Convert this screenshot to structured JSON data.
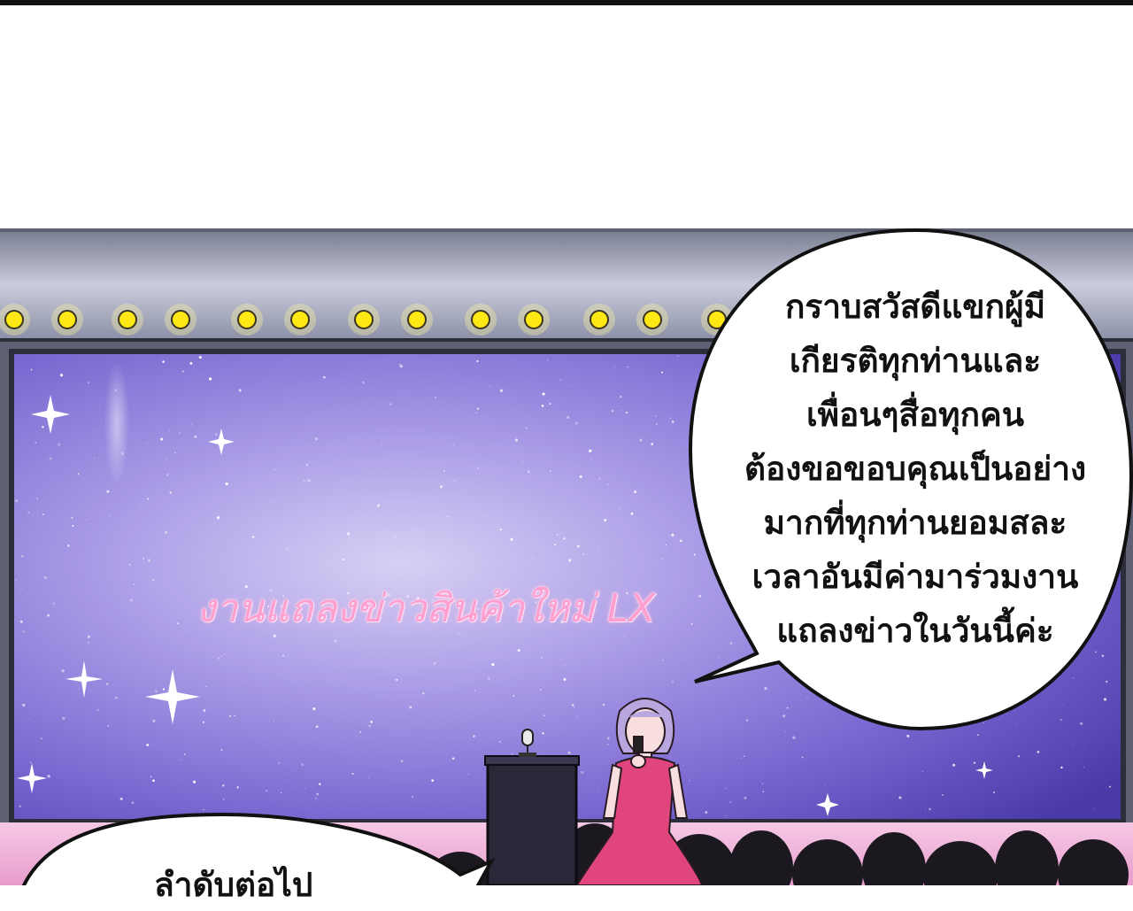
{
  "screen_caption": "งานแถลงข่าวสินค้าใหม่ LX",
  "speech_bubble": {
    "lines": [
      "กราบสวัสดีแขกผู้มี",
      "เกียรติทุกท่านและ",
      "เพื่อนๆสื่อทุกคน",
      "ต้องขอขอบคุณเป็นอย่าง",
      "มากที่ทุกท่านยอมสละ",
      "เวลาอันมีค่ามาร่วมงาน",
      "แถลงข่าวในวันนี้ค่ะ"
    ]
  },
  "bottom_bubble": {
    "partial_text": "ลำดับต่อไป"
  },
  "colors": {
    "stage_frame": "#5e6173",
    "screen_purple": "#8a7fd8",
    "bulb_yellow": "#ffe814",
    "dress_pink": "#e0457e",
    "audience_pink": "#f4b8dc"
  }
}
